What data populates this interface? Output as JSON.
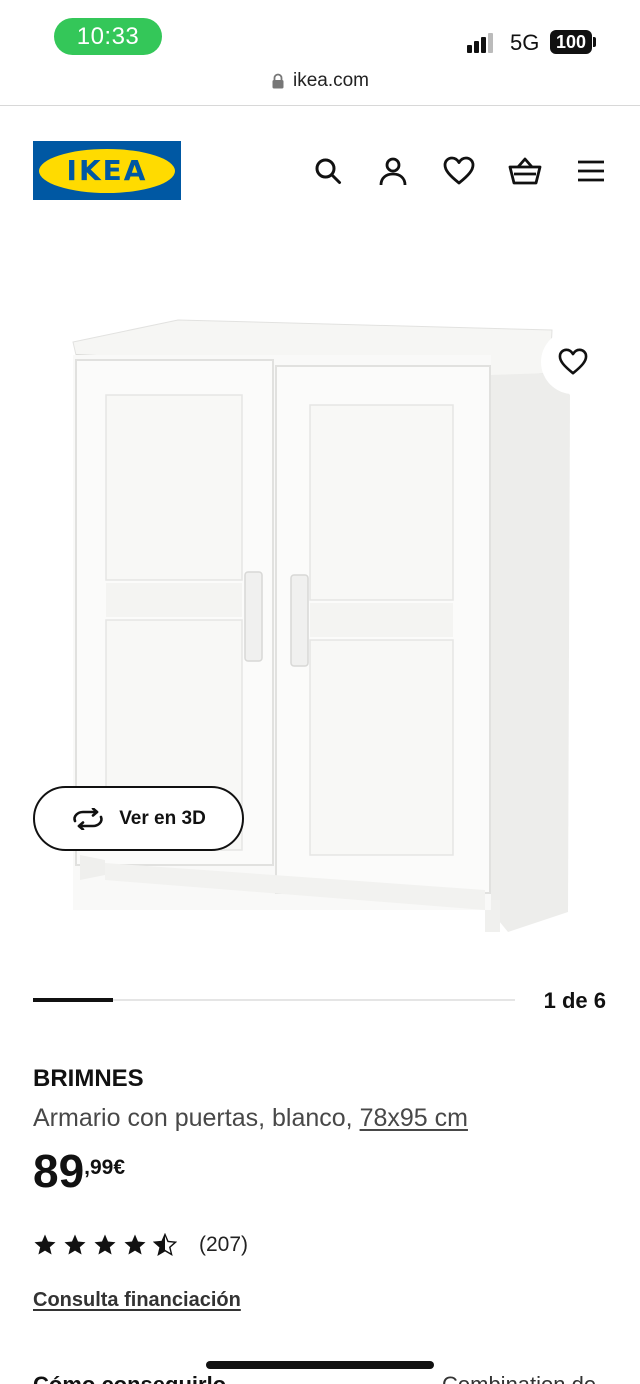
{
  "status_bar": {
    "time": "10:33",
    "network": "5G",
    "battery": "100"
  },
  "browser": {
    "url": "ikea.com"
  },
  "header": {
    "logo_text": "IKEA",
    "icons": [
      "search-icon",
      "account-icon",
      "wishlist-icon",
      "basket-icon",
      "menu-icon"
    ]
  },
  "gallery": {
    "view_3d_label": "Ver en 3D",
    "current": 1,
    "total": 6,
    "counter": "1 de 6",
    "progress_fraction": 0.1667
  },
  "product": {
    "name": "BRIMNES",
    "description": "Armario con puertas, blanco, ",
    "size": "78x95 cm",
    "price_integer": "89",
    "price_decimal": ",99€",
    "rating_value": 4.5,
    "rating_max": 5,
    "review_count": "(207)",
    "financing_link": "Consulta financiación"
  },
  "bottom_peek": {
    "left": "Cómo conseguirlo",
    "right": "Combination de"
  },
  "colors": {
    "ikea_blue": "#0058a3",
    "ikea_yellow": "#ffdb00",
    "status_green": "#34c759"
  }
}
